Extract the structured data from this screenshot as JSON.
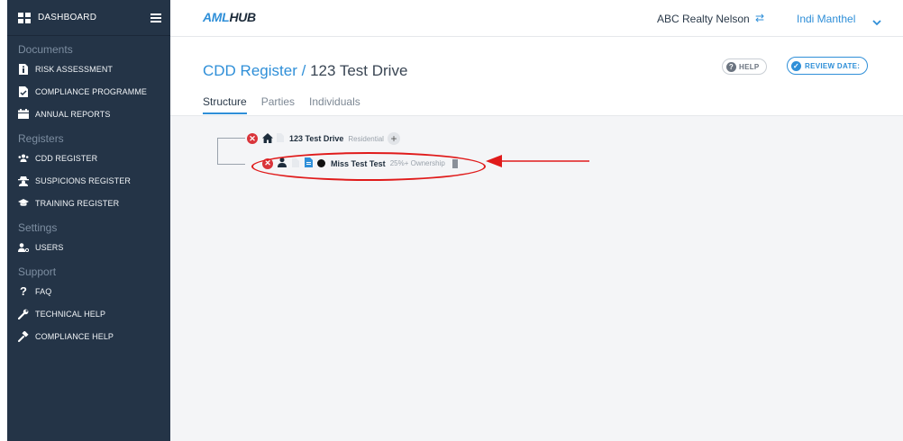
{
  "sidebar": {
    "dashboard_label": "DASHBOARD",
    "sections": {
      "documents": "Documents",
      "registers": "Registers",
      "settings": "Settings",
      "support": "Support"
    },
    "items": {
      "risk_assessment": "RISK ASSESSMENT",
      "compliance_programme": "COMPLIANCE PROGRAMME",
      "annual_reports": "ANNUAL REPORTS",
      "cdd_register": "CDD REGISTER",
      "suspicions_register": "SUSPICIONS REGISTER",
      "training_register": "TRAINING REGISTER",
      "users": "USERS",
      "faq": "FAQ",
      "technical_help": "TECHNICAL HELP",
      "compliance_help": "COMPLIANCE HELP"
    }
  },
  "topbar": {
    "logo_aml": "AML",
    "logo_hub": "HUB",
    "organisation": "ABC Realty Nelson",
    "user_name": "Indi Manthel"
  },
  "header": {
    "breadcrumb_root": "CDD Register",
    "breadcrumb_sep": "/",
    "breadcrumb_current": "123 Test Drive",
    "help_label": "HELP",
    "review_label": "REVIEW DATE:",
    "tabs": [
      "Structure",
      "Parties",
      "Individuals"
    ]
  },
  "tree": {
    "property": {
      "label": "123 Test Drive",
      "type": "Residential"
    },
    "individual": {
      "label": "Miss Test Test",
      "role": "25%+ Ownership"
    }
  },
  "colors": {
    "sidebar_bg": "#243447",
    "accent": "#2f8fd8",
    "danger": "#d9343a",
    "annotation": "#e01b1b"
  }
}
